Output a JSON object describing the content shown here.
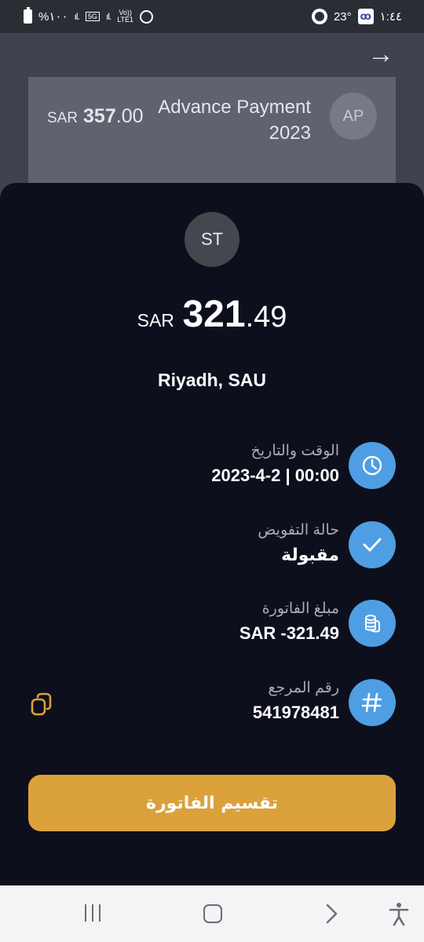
{
  "status_bar": {
    "battery_text": "%١٠٠",
    "network_5g": "5G",
    "volte_top": "Vo))",
    "volte_bottom": "LTE1",
    "temperature": "23°",
    "time": "١:٤٤"
  },
  "background_transaction": {
    "currency": "SAR",
    "amount_int": "357",
    "amount_dec": ".00",
    "title_line1": "Advance Payment",
    "title_line2": "2023",
    "avatar_initials": "AP"
  },
  "details": {
    "avatar_initials": "ST",
    "currency": "SAR",
    "amount_int": "321",
    "amount_dec": ".49",
    "location": "Riyadh, SAU",
    "rows": [
      {
        "label": "الوقت والتاريخ",
        "value": "2023-4-2 | 00:00",
        "icon": "clock-icon"
      },
      {
        "label": "حالة التفويض",
        "value": "مقبولة",
        "icon": "check-icon"
      },
      {
        "label": "مبلغ الفاتورة",
        "value": "SAR -321.49",
        "icon": "coins-icon"
      },
      {
        "label": "رقم المرجع",
        "value": "541978481",
        "icon": "hash-icon"
      }
    ],
    "split_button_label": "تقسيم الفاتورة"
  },
  "colors": {
    "sheet_bg": "#0d0f1d",
    "icon_bg": "#4f9ee3",
    "accent_button": "#dba13a",
    "copy_icon": "#dba13a"
  }
}
